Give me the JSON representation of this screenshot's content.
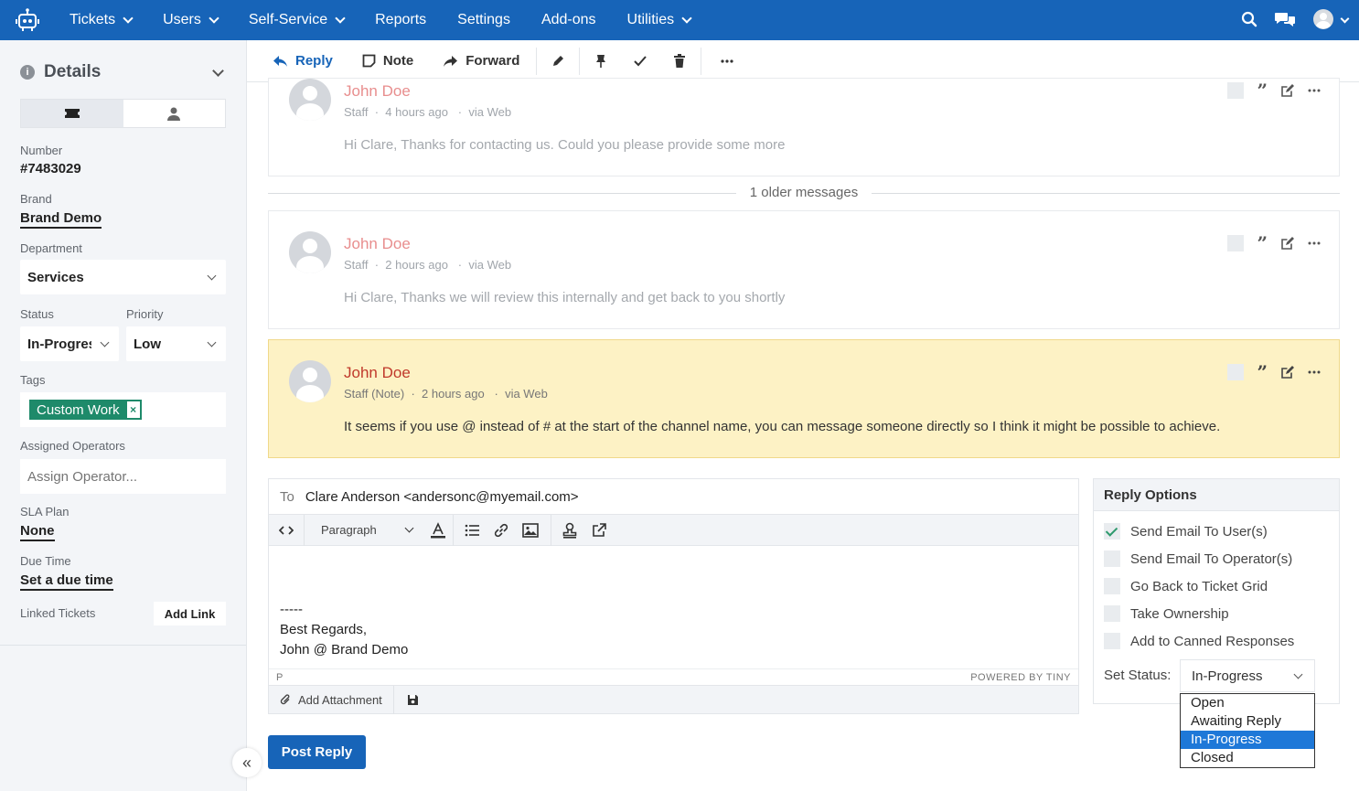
{
  "colors": {
    "brand": "#1764b8",
    "tag": "#1e8a6a",
    "note_bg": "#fdf2c5",
    "note_name": "#c0392b",
    "selected_option": "#1e78d8"
  },
  "nav": {
    "items": [
      {
        "label": "Tickets",
        "has_menu": true
      },
      {
        "label": "Users",
        "has_menu": true
      },
      {
        "label": "Self-Service",
        "has_menu": true
      },
      {
        "label": "Reports",
        "has_menu": false
      },
      {
        "label": "Settings",
        "has_menu": false
      },
      {
        "label": "Add-ons",
        "has_menu": false
      },
      {
        "label": "Utilities",
        "has_menu": true
      }
    ],
    "right_icons": [
      "search-icon",
      "chat-icon",
      "user-avatar-icon",
      "chevron-down-icon"
    ]
  },
  "sidebar": {
    "title": "Details",
    "tabs": [
      "ticket-icon",
      "user-icon"
    ],
    "number": {
      "label": "Number",
      "value": "#7483029"
    },
    "brand": {
      "label": "Brand",
      "value": "Brand Demo"
    },
    "department": {
      "label": "Department",
      "value": "Services"
    },
    "status": {
      "label": "Status",
      "value": "In-Progress"
    },
    "priority": {
      "label": "Priority",
      "value": "Low"
    },
    "tags": {
      "label": "Tags",
      "items": [
        "Custom Work"
      ]
    },
    "assigned": {
      "label": "Assigned Operators",
      "placeholder": "Assign Operator..."
    },
    "sla": {
      "label": "SLA Plan",
      "value": "None"
    },
    "due": {
      "label": "Due Time",
      "value": "Set a due time"
    },
    "linked": {
      "label": "Linked Tickets",
      "button": "Add Link"
    }
  },
  "toolbar": {
    "reply": "Reply",
    "note": "Note",
    "forward": "Forward",
    "icons": [
      "pencil-icon",
      "pin-icon",
      "check-icon",
      "trash-icon",
      "more-icon"
    ]
  },
  "messages": [
    {
      "name": "John Doe",
      "role": "Staff",
      "time": "4 hours ago",
      "via": "via Web",
      "body": "Hi Clare, Thanks for contacting us. Could you please provide some more"
    },
    {
      "name": "John Doe",
      "role": "Staff",
      "time": "2 hours ago",
      "via": "via Web",
      "body": "Hi Clare, Thanks we will review this internally and get back to you shortly"
    },
    {
      "name": "John Doe",
      "role": "Staff (Note)",
      "time": "2 hours ago",
      "via": "via Web",
      "body": "It seems if you use @ instead of # at the start of the channel name, you can message someone directly so I think it might be possible to achieve."
    }
  ],
  "older_messages": "1 older messages",
  "composer": {
    "to_label": "To",
    "to_value": "Clare Anderson <andersonc@myemail.com>",
    "format": "Paragraph",
    "body_lines": [
      "-----",
      "Best Regards,",
      "John @ Brand Demo"
    ],
    "status_path": "P",
    "powered_by": "POWERED BY TINY",
    "attach": "Add Attachment"
  },
  "post_reply": "Post Reply",
  "reply_options": {
    "title": "Reply Options",
    "options": [
      {
        "label": "Send Email To User(s)",
        "checked": true
      },
      {
        "label": "Send Email To Operator(s)",
        "checked": false
      },
      {
        "label": "Go Back to Ticket Grid",
        "checked": false
      },
      {
        "label": "Take Ownership",
        "checked": false
      },
      {
        "label": "Add to Canned Responses",
        "checked": false
      }
    ],
    "set_status_label": "Set Status:",
    "set_status_value": "In-Progress",
    "status_options": [
      "Open",
      "Awaiting Reply",
      "In-Progress",
      "Closed"
    ],
    "selected_option": "In-Progress"
  }
}
